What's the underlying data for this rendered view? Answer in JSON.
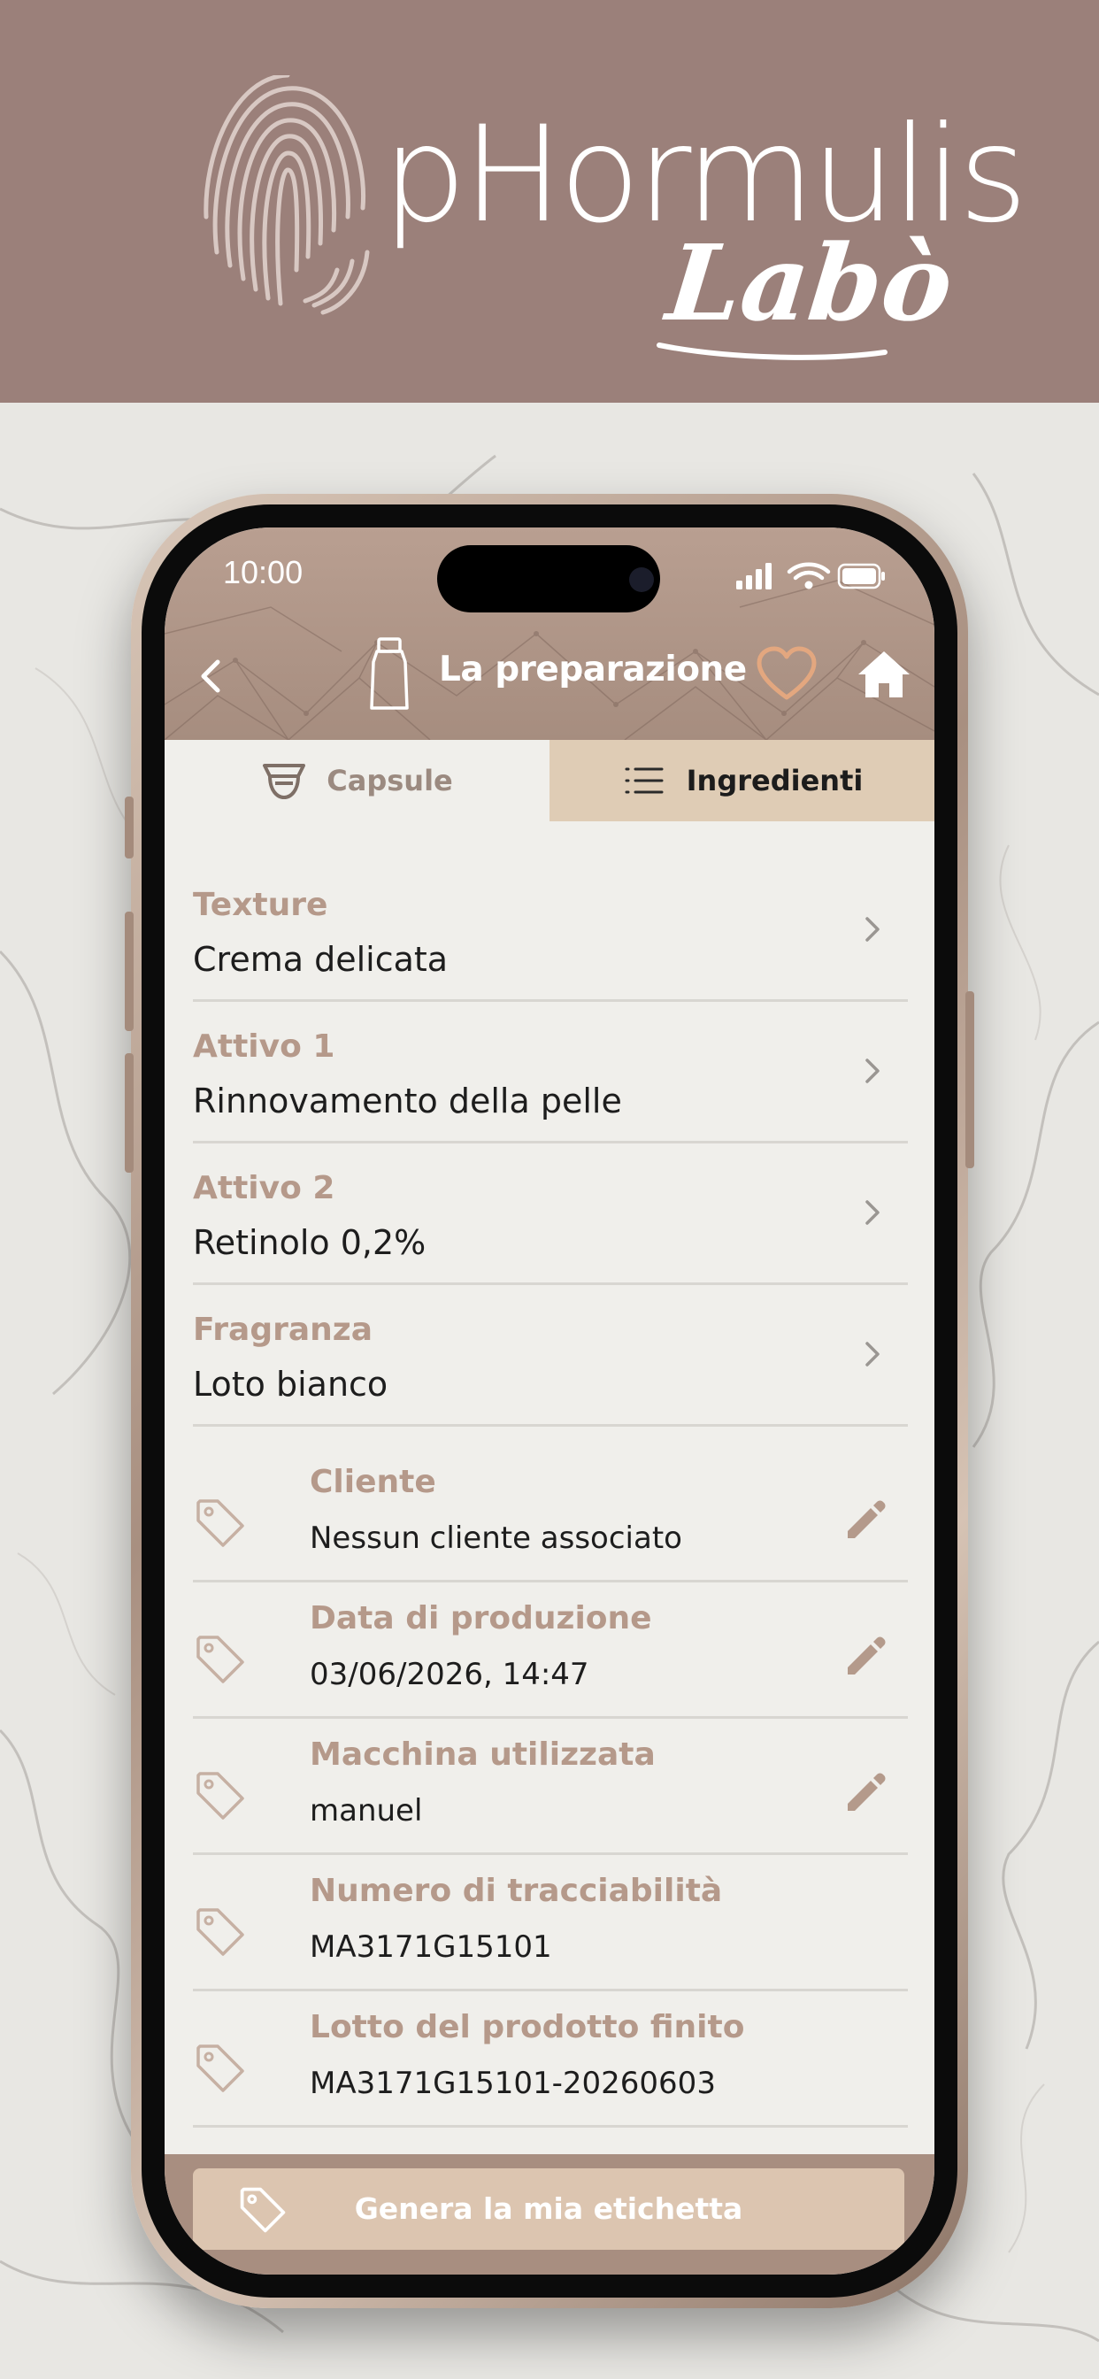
{
  "banner": {
    "brand_name": "pHormulis",
    "brand_sub": "Labò"
  },
  "status_bar": {
    "time": "10:00"
  },
  "app_header": {
    "title": "La preparazione",
    "back_icon": "chevron-left-icon",
    "bottle_icon": "bottle-icon",
    "favorite_icon": "heart-outline-icon",
    "home_icon": "home-icon"
  },
  "tabs": [
    {
      "label": "Capsule",
      "icon": "capsule-icon",
      "selected": true
    },
    {
      "label": "Ingredienti",
      "icon": "list-icon",
      "selected": false
    }
  ],
  "ingredients": [
    {
      "label": "Texture",
      "value": "Crema delicata"
    },
    {
      "label": "Attivo 1",
      "value": "Rinnovamento della pelle"
    },
    {
      "label": "Attivo 2",
      "value": "Retinolo 0,2%"
    },
    {
      "label": "Fragranza",
      "value": "Loto bianco"
    }
  ],
  "details": [
    {
      "label": "Cliente",
      "value": "Nessun cliente associato",
      "editable": true
    },
    {
      "label": "Data di produzione",
      "value": "03/06/2026, 14:47",
      "editable": true
    },
    {
      "label": "Macchina utilizzata",
      "value": "manuel",
      "editable": true
    },
    {
      "label": "Numero di tracciabilità",
      "value": "MA3171G15101",
      "editable": false
    },
    {
      "label": "Lotto del prodotto finito",
      "value": "MA3171G15101-20260603",
      "editable": false
    }
  ],
  "cta": {
    "label": "Genera la mia etichetta",
    "icon": "tag-icon"
  },
  "colors": {
    "banner": "#9b807a",
    "accent_label": "#b5998a",
    "tab_inactive_bg": "#dfccb5",
    "cta_bg": "#dcc5b0",
    "heart": "#e3a77f"
  }
}
